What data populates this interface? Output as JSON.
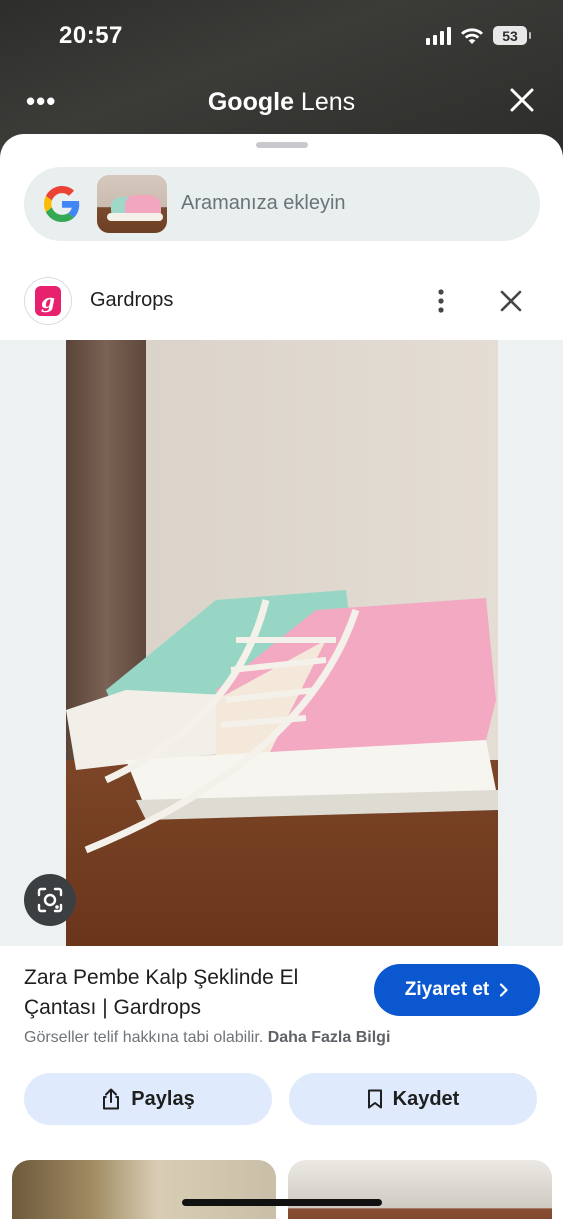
{
  "status_bar": {
    "time": "20:57",
    "battery": "53"
  },
  "lens_header": {
    "title_google": "Google",
    "title_lens": "Lens",
    "menu_icon": "more-horizontal-icon",
    "close_icon": "close-icon"
  },
  "search": {
    "placeholder": "Aramanıza ekleyin"
  },
  "source": {
    "name": "Gardrops",
    "logo_letter": "g"
  },
  "result": {
    "title": "Zara Pembe Kalp Şeklinde El Çantası | Gardrops",
    "visit_label": "Ziyaret et",
    "copyright_text": "Görseller telif hakkına tabi olabilir.",
    "copyright_link": "Daha Fazla Bilgi"
  },
  "actions": {
    "share_label": "Paylaş",
    "save_label": "Kaydet"
  },
  "colors": {
    "accent": "#0b57d0",
    "action_bg": "#dfeafc",
    "brand_pink": "#e8216f"
  }
}
